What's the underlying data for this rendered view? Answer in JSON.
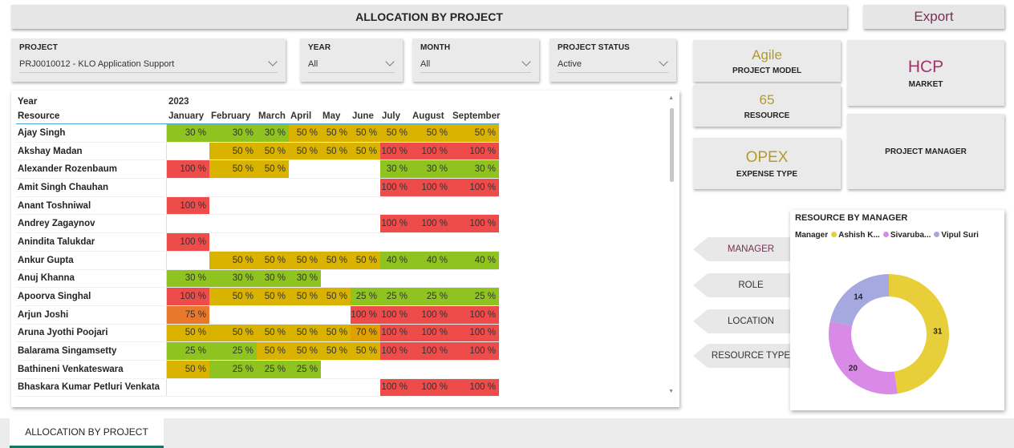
{
  "header": {
    "title": "ALLOCATION BY PROJECT",
    "export_label": "Export"
  },
  "filters": {
    "project": {
      "label": "PROJECT",
      "value": "PRJ0010012 - KLO Application Support"
    },
    "year": {
      "label": "YEAR",
      "value": "All"
    },
    "month": {
      "label": "MONTH",
      "value": "All"
    },
    "status": {
      "label": "PROJECT STATUS",
      "value": "Active"
    }
  },
  "matrix": {
    "row_header_1": "Year",
    "year": "2023",
    "row_header_2": "Resource",
    "months": [
      "January",
      "February",
      "March",
      "April",
      "May",
      "June",
      "July",
      "August",
      "September"
    ],
    "rows": [
      {
        "name": "Ajay Singh",
        "cells": [
          "30 %",
          "30 %",
          "30 %",
          "50 %",
          "50 %",
          "50 %",
          "50 %",
          "50 %",
          "50 %"
        ]
      },
      {
        "name": "Akshay Madan",
        "cells": [
          "",
          "50 %",
          "50 %",
          "50 %",
          "50 %",
          "50 %",
          "100 %",
          "100 %",
          "100 %"
        ]
      },
      {
        "name": "Alexander Rozenbaum",
        "cells": [
          "100 %",
          "50 %",
          "50 %",
          "",
          "",
          "",
          "30 %",
          "30 %",
          "30 %"
        ]
      },
      {
        "name": "Amit Singh Chauhan",
        "cells": [
          "",
          "",
          "",
          "",
          "",
          "",
          "100 %",
          "100 %",
          "100 %"
        ]
      },
      {
        "name": "Anant Toshniwal",
        "cells": [
          "100 %",
          "",
          "",
          "",
          "",
          "",
          "",
          "",
          ""
        ]
      },
      {
        "name": "Andrey Zagaynov",
        "cells": [
          "",
          "",
          "",
          "",
          "",
          "",
          "100 %",
          "100 %",
          "100 %"
        ]
      },
      {
        "name": "Anindita Talukdar",
        "cells": [
          "100 %",
          "",
          "",
          "",
          "",
          "",
          "",
          "",
          ""
        ]
      },
      {
        "name": "Ankur Gupta",
        "cells": [
          "",
          "50 %",
          "50 %",
          "50 %",
          "50 %",
          "50 %",
          "40 %",
          "40 %",
          "40 %"
        ]
      },
      {
        "name": "Anuj Khanna",
        "cells": [
          "30 %",
          "30 %",
          "30 %",
          "30 %",
          "",
          "",
          "",
          "",
          ""
        ]
      },
      {
        "name": "Apoorva Singhal",
        "cells": [
          "100 %",
          "50 %",
          "50 %",
          "50 %",
          "50 %",
          "25 %",
          "25 %",
          "25 %",
          "25 %"
        ]
      },
      {
        "name": "Arjun Joshi",
        "cells": [
          "75 %",
          "",
          "",
          "",
          "",
          "100 %",
          "100 %",
          "100 %",
          "100 %"
        ]
      },
      {
        "name": "Aruna Jyothi Poojari",
        "cells": [
          "50 %",
          "50 %",
          "50 %",
          "50 %",
          "50 %",
          "70 %",
          "100 %",
          "100 %",
          "100 %"
        ]
      },
      {
        "name": "Balarama Singamsetty",
        "cells": [
          "25 %",
          "25 %",
          "50 %",
          "50 %",
          "50 %",
          "50 %",
          "100 %",
          "100 %",
          "100 %"
        ]
      },
      {
        "name": "Bathineni Venkateswara",
        "cells": [
          "50 %",
          "25 %",
          "25 %",
          "25 %",
          "",
          "",
          "",
          "",
          ""
        ]
      },
      {
        "name": "Bhaskara Kumar Petluri Venkata",
        "cells": [
          "",
          "",
          "",
          "",
          "",
          "",
          "100 %",
          "100 %",
          "100 %"
        ]
      }
    ],
    "colors": {
      "25": "#8fc31f",
      "30": "#8fc31f",
      "40": "#8fc31f",
      "50": "#d9b300",
      "70": "#e0a000",
      "75": "#e8782c",
      "100": "#ee4b4b"
    }
  },
  "cards": {
    "project_model": {
      "value": "Agile",
      "caption": "PROJECT MODEL"
    },
    "resource": {
      "value": "65",
      "caption": "RESOURCE"
    },
    "expense_type": {
      "value": "OPEX",
      "caption": "EXPENSE TYPE"
    },
    "market": {
      "value": "HCP",
      "caption": "MARKET"
    },
    "project_manager": {
      "caption": "PROJECT MANAGER"
    }
  },
  "nav": {
    "manager": "MANAGER",
    "role": "ROLE",
    "location": "LOCATION",
    "resource_type": "RESOURCE TYPE"
  },
  "chart_data": {
    "type": "pie",
    "title": "RESOURCE BY MANAGER",
    "legend_title": "Manager",
    "legend_position": "top",
    "categories": [
      "Ashish K...",
      "Sivaruba...",
      "Vipul Suri"
    ],
    "values": [
      31,
      20,
      14
    ],
    "colors": [
      "#e8cf3a",
      "#d98ae6",
      "#a6a8e0"
    ]
  },
  "footer": {
    "tab_label": "ALLOCATION BY PROJECT"
  }
}
